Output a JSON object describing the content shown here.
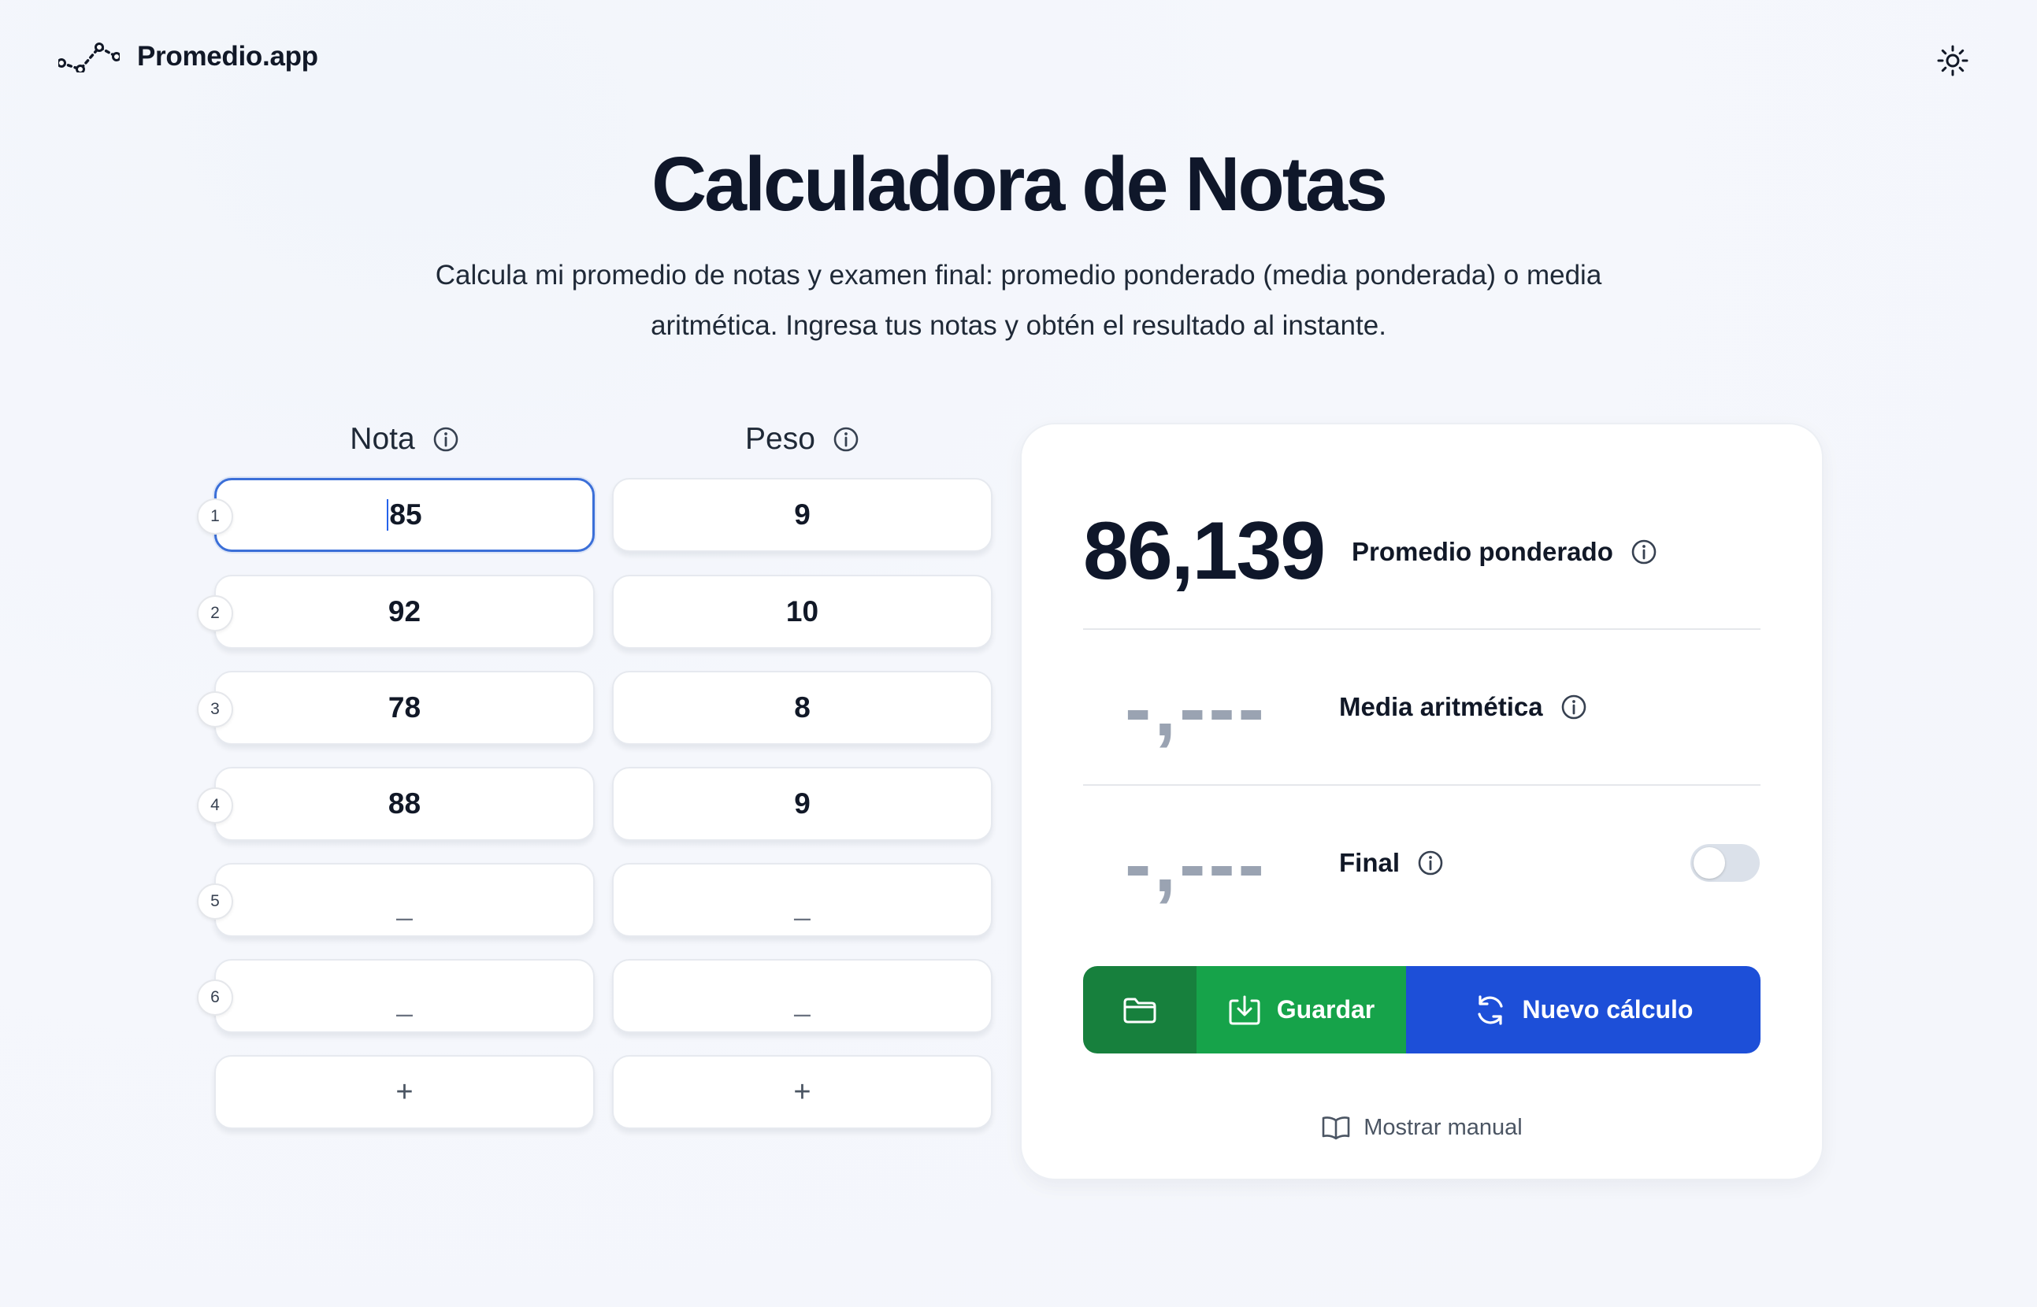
{
  "header": {
    "brand": "Promedio.app",
    "logo_icon": "chart-line-logo-icon",
    "theme_icon": "sun-icon"
  },
  "hero": {
    "title": "Calculadora de Notas",
    "subtitle_line1": "Calcula mi promedio de notas y examen final: promedio ponderado (media ponderada) o media",
    "subtitle_line2": "aritmética. Ingresa tus notas y obtén el resultado al instante."
  },
  "columns": {
    "nota_label": "Nota",
    "peso_label": "Peso"
  },
  "rows": [
    {
      "num": "1",
      "nota": "85",
      "peso": "9"
    },
    {
      "num": "2",
      "nota": "92",
      "peso": "10"
    },
    {
      "num": "3",
      "nota": "78",
      "peso": "8"
    },
    {
      "num": "4",
      "nota": "88",
      "peso": "9"
    },
    {
      "num": "5",
      "nota": "_",
      "peso": "_"
    },
    {
      "num": "6",
      "nota": "_",
      "peso": "_"
    }
  ],
  "add_label": "+",
  "results": {
    "weighted_value": "86,139",
    "weighted_label": "Promedio ponderado",
    "arith_value": "-,---",
    "arith_label": "Media aritmética",
    "final_value": "-,---",
    "final_label": "Final",
    "final_toggle_on": false
  },
  "actions": {
    "save_label": "Guardar",
    "new_label": "Nuevo cálculo",
    "manual_label": "Mostrar manual"
  },
  "colors": {
    "primary_blue": "#1d4fd8",
    "save_green": "#16a34a",
    "folder_green": "#17803d",
    "active_border": "#3b6fd8"
  }
}
